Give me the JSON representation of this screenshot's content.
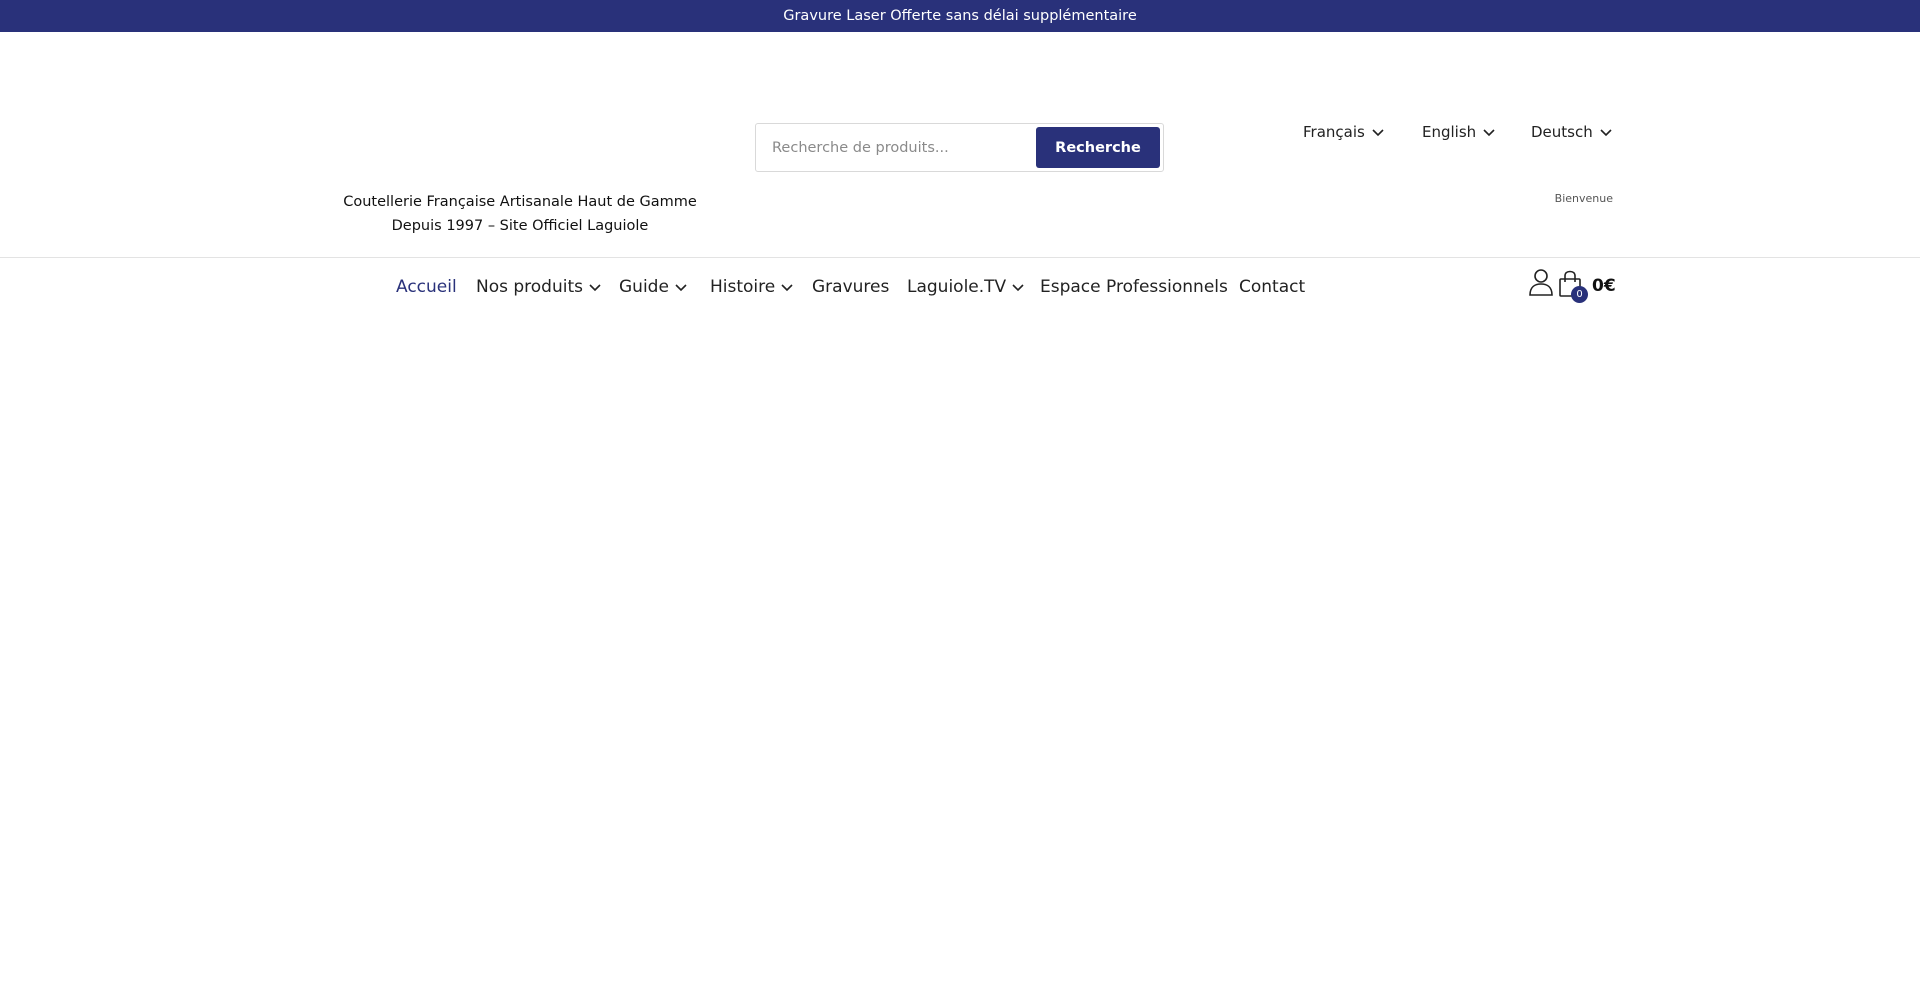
{
  "topbar": {
    "text": "Gravure Laser Offerte sans délai supplémentaire"
  },
  "header": {
    "tagline_line1": "Coutellerie Française Artisanale Haut de Gamme",
    "tagline_line2": "Depuis 1997 – Site Officiel Laguiole",
    "search": {
      "placeholder": "Recherche de produits...",
      "button_label": "Recherche"
    },
    "languages": [
      "Français",
      "English",
      "Deutsch"
    ],
    "welcome": "Bienvenue"
  },
  "nav": {
    "items": [
      {
        "label": "Accueil",
        "active": true,
        "has_dropdown": false
      },
      {
        "label": "Nos produits",
        "has_dropdown": true
      },
      {
        "label": "Guide",
        "has_dropdown": true
      },
      {
        "label": "Histoire",
        "has_dropdown": true
      },
      {
        "label": "Gravures",
        "has_dropdown": false
      },
      {
        "label": "Laguiole.TV",
        "has_dropdown": true
      },
      {
        "label": "Espace Professionnels",
        "has_dropdown": false
      },
      {
        "label": "Contact",
        "has_dropdown": false
      }
    ]
  },
  "cart": {
    "count": "0",
    "total": "0€"
  },
  "colors": {
    "brand": "#29317a",
    "divider": "#e3e3e3"
  }
}
